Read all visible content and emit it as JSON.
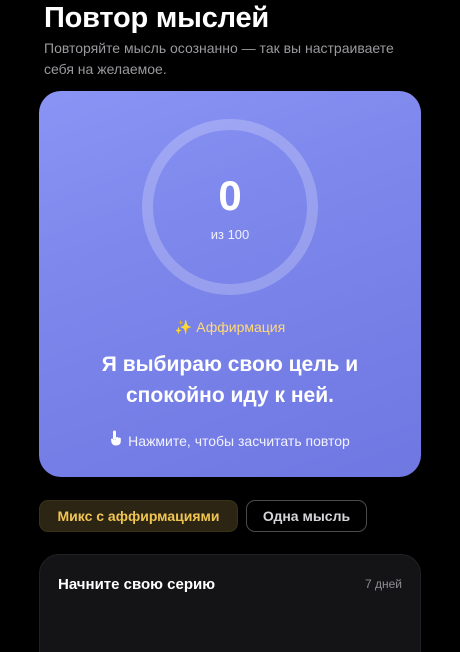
{
  "header": {
    "title": "Повтор мыслей",
    "subtitle": "Повторяйте мысль осознанно — так вы настраиваете себя на желаемое."
  },
  "counter": {
    "value": "0",
    "total_label": "из 100",
    "progress_fraction": 0,
    "affirmation_label": "Аффирмация",
    "affirmation_text": "Я выбираю свою цель и спокойно иду к ней.",
    "tap_hint": "Нажмите, чтобы засчитать повтор"
  },
  "modes": {
    "mix_label": "Микс с аффирмациями",
    "single_label": "Одна мысль",
    "selected": "mix"
  },
  "streak": {
    "title": "Начните свою серию",
    "days": "7 дней"
  },
  "colors": {
    "accent_gold": "#f0c552",
    "card_gradient_start": "#8a94f5",
    "card_gradient_end": "#6f77e2",
    "background": "#000000"
  },
  "icons": {
    "affirmation": "sparkles-icon",
    "tap": "pointing-hand-icon"
  }
}
